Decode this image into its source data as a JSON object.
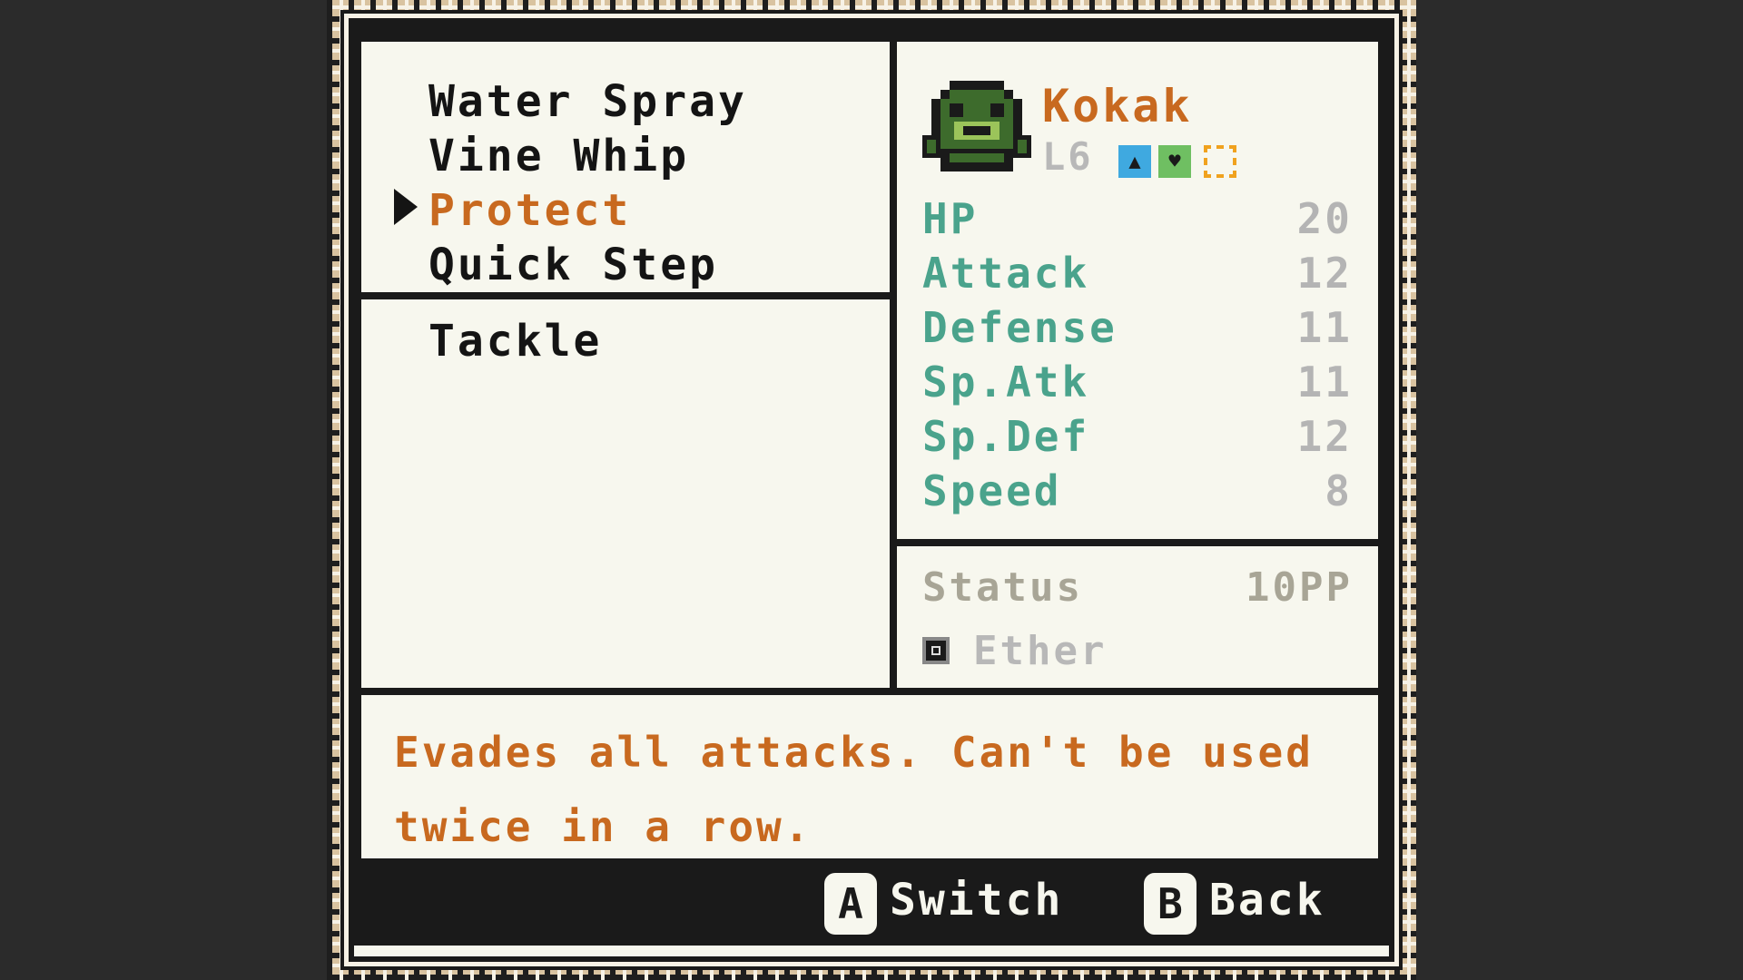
{
  "moves": {
    "known": [
      {
        "label": "Water Spray",
        "selected": false
      },
      {
        "label": "Vine Whip",
        "selected": false
      },
      {
        "label": "Protect",
        "selected": true
      },
      {
        "label": "Quick Step",
        "selected": false
      }
    ],
    "new": [
      {
        "label": "Tackle"
      }
    ]
  },
  "monster": {
    "name": "Kokak",
    "level": "L6",
    "type_icons": [
      "water-type-icon",
      "grass-type-icon",
      "gold-type-icon"
    ],
    "type_colors": [
      "#3fa9e0",
      "#6fbf62",
      "#f0a21e"
    ],
    "stats": [
      {
        "label": "HP",
        "value": "20"
      },
      {
        "label": "Attack",
        "value": "12"
      },
      {
        "label": "Defense",
        "value": "11"
      },
      {
        "label": "Sp.Atk",
        "value": "11"
      },
      {
        "label": "Sp.Def",
        "value": "12"
      },
      {
        "label": "Speed",
        "value": "8"
      }
    ]
  },
  "move_info": {
    "category": "Status",
    "pp": "10PP",
    "item": "Ether",
    "description": "Evades all attacks. Can't be used twice in a row."
  },
  "footer": {
    "a_key": "A",
    "a_label": "Switch",
    "b_key": "B",
    "b_label": "Back"
  },
  "colors": {
    "selected_text": "#c8691f",
    "stat_label": "#4aa38c",
    "panel_bg": "#f7f7ee"
  }
}
